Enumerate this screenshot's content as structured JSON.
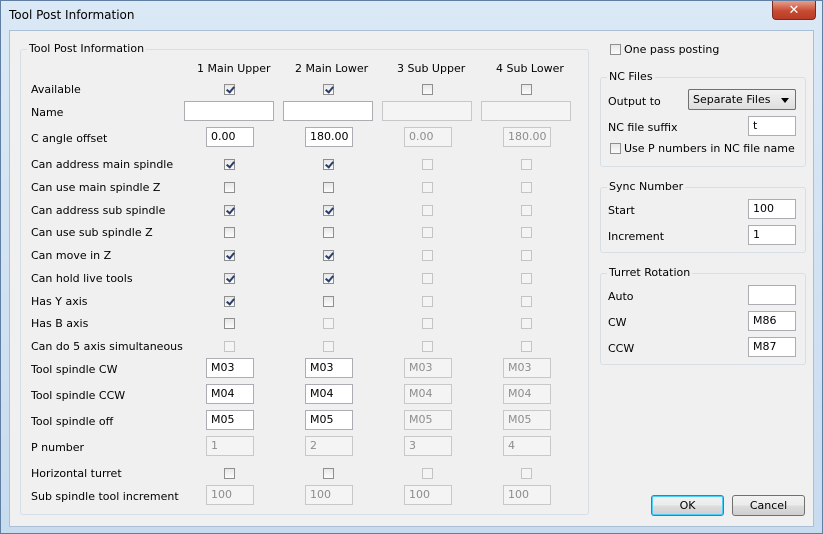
{
  "window": {
    "title": "Tool Post Information"
  },
  "tool_post": {
    "group_label": "Tool Post Information",
    "columns": [
      "1 Main Upper",
      "2 Main Lower",
      "3 Sub Upper",
      "4 Sub Lower"
    ],
    "rows": {
      "available": "Available",
      "name": "Name",
      "c_angle": "C angle offset",
      "addr_main": "Can address main spindle",
      "use_main_z": "Can use main spindle Z",
      "addr_sub": "Can address sub spindle",
      "use_sub_z": "Can use sub spindle Z",
      "move_z": "Can move in Z",
      "live_tools": "Can hold live tools",
      "y_axis": "Has Y axis",
      "b_axis": "Has B axis",
      "five_axis": "Can do 5 axis simultaneous",
      "spindle_cw": "Tool spindle CW",
      "spindle_ccw": "Tool spindle CCW",
      "spindle_off": "Tool spindle off",
      "p_number": "P number",
      "horiz_turret": "Horizontal turret",
      "sub_incr": "Sub spindle tool increment"
    },
    "values": {
      "name": [
        "",
        "",
        "",
        ""
      ],
      "c_angle": [
        "0.00",
        "180.00",
        "0.00",
        "180.00"
      ],
      "spindle_cw": [
        "M03",
        "M03",
        "M03",
        "M03"
      ],
      "spindle_ccw": [
        "M04",
        "M04",
        "M04",
        "M04"
      ],
      "spindle_off": [
        "M05",
        "M05",
        "M05",
        "M05"
      ],
      "p_number": [
        "1",
        "2",
        "3",
        "4"
      ],
      "sub_incr": [
        "100",
        "100",
        "100",
        "100"
      ]
    }
  },
  "one_pass": {
    "label": "One pass posting",
    "checked": false
  },
  "nc_files": {
    "group_label": "NC Files",
    "output_label": "Output to",
    "output_value": "Separate Files",
    "suffix_label": "NC file suffix",
    "suffix_value": "t",
    "use_p_label": "Use P numbers in NC file name",
    "use_p_checked": false
  },
  "sync": {
    "group_label": "Sync Number",
    "start_label": "Start",
    "start_value": "100",
    "incr_label": "Increment",
    "incr_value": "1"
  },
  "turret": {
    "group_label": "Turret Rotation",
    "auto_label": "Auto",
    "auto_value": "",
    "cw_label": "CW",
    "cw_value": "M86",
    "ccw_label": "CCW",
    "ccw_value": "M87"
  },
  "buttons": {
    "ok": "OK",
    "cancel": "Cancel"
  },
  "icons": {
    "close": "close-icon"
  }
}
